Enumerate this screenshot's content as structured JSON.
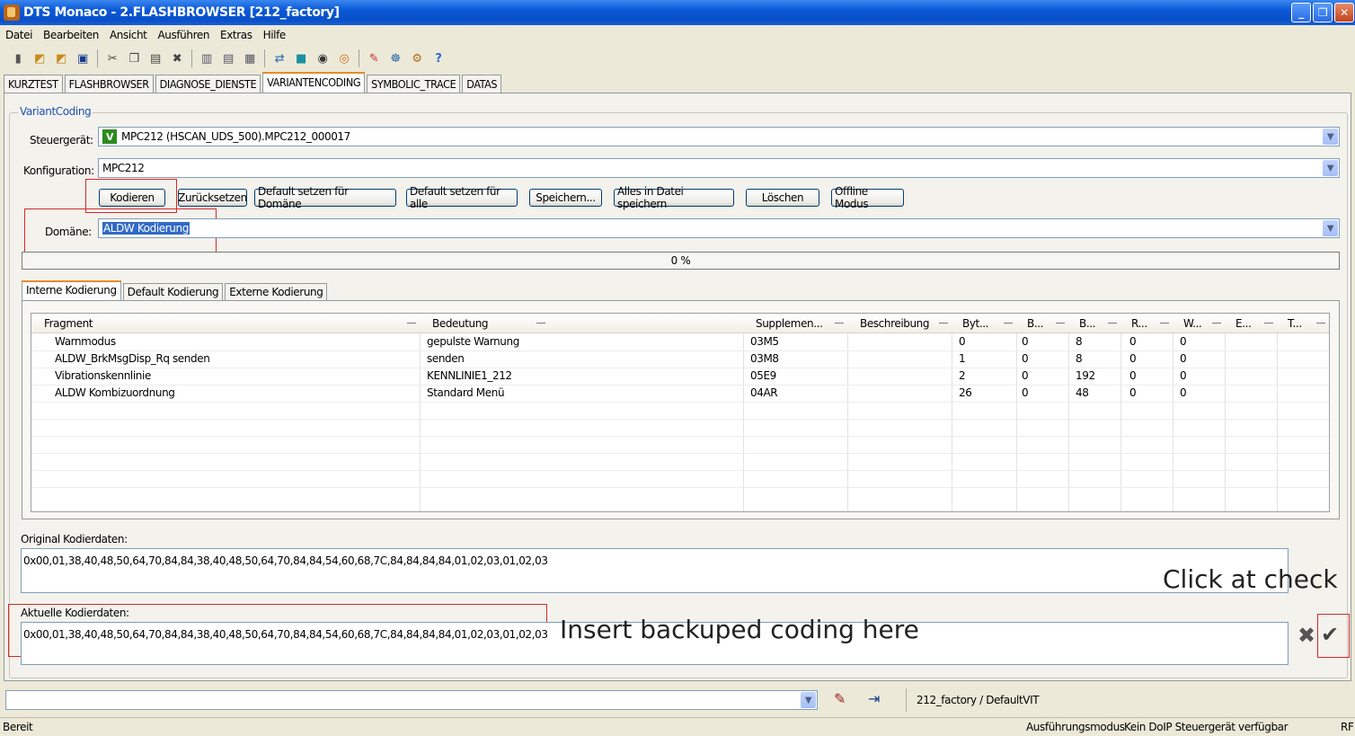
{
  "window": {
    "title": "DTS Monaco  - 2.FLASHBROWSER [212_factory]"
  },
  "menu": [
    "Datei",
    "Bearbeiten",
    "Ansicht",
    "Ausführen",
    "Extras",
    "Hilfe"
  ],
  "toolbar_icons": [
    "new-icon",
    "open-icon",
    "open-folder-icon",
    "save-icon",
    "cut-icon",
    "copy-icon",
    "paste-icon",
    "delete-icon",
    "layout-1-icon",
    "layout-2-icon",
    "layout-3-icon",
    "connect-icon",
    "stop-icon",
    "record-icon",
    "trace-icon",
    "ecu-icon",
    "network-icon",
    "settings-icon",
    "help-icon"
  ],
  "main_tabs": [
    "KURZTEST",
    "FLASHBROWSER",
    "DIAGNOSE_DIENSTE",
    "VARIANTENCODING",
    "SYMBOLIC_TRACE",
    "DATAS"
  ],
  "active_tab": "VARIANTENCODING",
  "group_title": "VariantCoding",
  "steuergeraet": {
    "label": "Steuergerät:",
    "badge": "V",
    "value": "MPC212 (HSCAN_UDS_500).MPC212_000017"
  },
  "konfiguration": {
    "label": "Konfiguration:",
    "value": "MPC212"
  },
  "buttons": {
    "kodieren": "Kodieren",
    "zuruecksetzen": "Zurücksetzen",
    "default_domaene": "Default setzen für Domäne",
    "default_alle": "Default setzen für alle",
    "speichern": "Speichern...",
    "alles_speichern": "Alles in Datei speichern",
    "loeschen": "Löschen",
    "offline": "Offline Modus"
  },
  "domaene": {
    "label": "Domäne:",
    "value": "ALDW Kodierung"
  },
  "progress": "0 %",
  "sub_tabs": [
    "Interne Kodierung",
    "Default Kodierung",
    "Externe Kodierung"
  ],
  "table": {
    "headers": [
      "Fragment",
      "Bedeutung",
      "Supplemen...",
      "Beschreibung",
      "Byt...",
      "B...",
      "B...",
      "R...",
      "W...",
      "E...",
      "T..."
    ],
    "rows": [
      [
        "Warnmodus",
        "gepulste Warnung",
        "03M5",
        "",
        "0",
        "0",
        "8",
        "0",
        "0",
        "",
        ""
      ],
      [
        "ALDW_BrkMsgDisp_Rq senden",
        "senden",
        "03M8",
        "",
        "1",
        "0",
        "8",
        "0",
        "0",
        "",
        ""
      ],
      [
        "Vibrationskennlinie",
        "KENNLINIE1_212",
        "05E9",
        "",
        "2",
        "0",
        "192",
        "0",
        "0",
        "",
        ""
      ],
      [
        "ALDW Kombizuordnung",
        "Standard Menü",
        "04AR",
        "",
        "26",
        "0",
        "48",
        "0",
        "0",
        "",
        ""
      ]
    ]
  },
  "original": {
    "label": "Original Kodierdaten:",
    "value": "0x00,01,38,40,48,50,64,70,84,84,38,40,48,50,64,70,84,84,54,60,68,7C,84,84,84,84,01,02,03,01,02,03"
  },
  "aktuelle": {
    "label": "Aktuelle Kodierdaten:",
    "value": "0x00,01,38,40,48,50,64,70,84,84,38,40,48,50,64,70,84,84,54,60,68,7C,84,84,84,84,01,02,03,01,02,03"
  },
  "annotations": {
    "check": "Click at check",
    "insert": "Insert backuped coding here"
  },
  "bottom": {
    "vit": "212_factory / DefaultVIT"
  },
  "status": {
    "left": "Bereit",
    "mode": "Ausführungsmodus",
    "doip": "Kein DoIP Steuergerät verfügbar",
    "rf": "RF"
  },
  "colors": {
    "annotation_box": "#d42a2a",
    "title_bar": "#0a58d6",
    "tab_accent": "#e68b2c"
  }
}
